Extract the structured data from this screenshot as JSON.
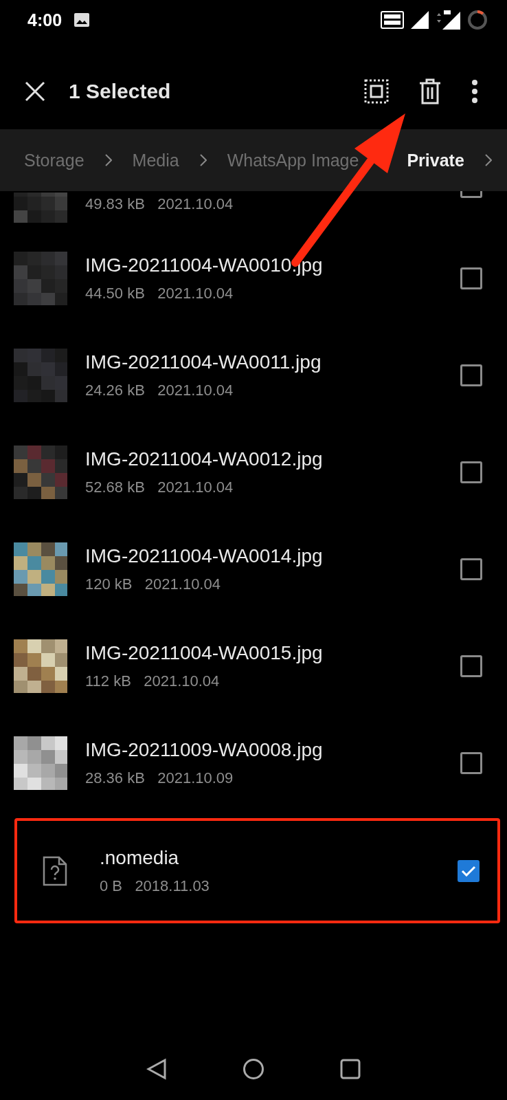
{
  "status_bar": {
    "time": "4:00"
  },
  "app_bar": {
    "title": "1 Selected"
  },
  "breadcrumb": [
    {
      "label": "Storage",
      "selected": false
    },
    {
      "label": "Media",
      "selected": false
    },
    {
      "label": "WhatsApp Image",
      "selected": false
    },
    {
      "label": "Private",
      "selected": true
    }
  ],
  "files": [
    {
      "kind": "picture",
      "partial": true,
      "size": "49.83 kB",
      "date": "2021.10.04",
      "checked": false,
      "highlighted": false
    },
    {
      "kind": "picture",
      "name": "IMG-20211004-WA0010.jpg",
      "size": "44.50 kB",
      "date": "2021.10.04",
      "checked": false,
      "highlighted": false
    },
    {
      "kind": "picture",
      "name": "IMG-20211004-WA0011.jpg",
      "size": "24.26 kB",
      "date": "2021.10.04",
      "checked": false,
      "highlighted": false
    },
    {
      "kind": "picture",
      "name": "IMG-20211004-WA0012.jpg",
      "size": "52.68 kB",
      "date": "2021.10.04",
      "checked": false,
      "highlighted": false
    },
    {
      "kind": "picture",
      "name": "IMG-20211004-WA0014.jpg",
      "size": "120 kB",
      "date": "2021.10.04",
      "checked": false,
      "highlighted": false
    },
    {
      "kind": "picture",
      "name": "IMG-20211004-WA0015.jpg",
      "size": "112 kB",
      "date": "2021.10.04",
      "checked": false,
      "highlighted": false
    },
    {
      "kind": "picture",
      "name": "IMG-20211009-WA0008.jpg",
      "size": "28.36 kB",
      "date": "2021.10.09",
      "checked": false,
      "highlighted": false
    },
    {
      "kind": "unknown",
      "name": ".nomedia",
      "size": "0 B",
      "date": "2018.11.03",
      "checked": true,
      "highlighted": true
    }
  ]
}
